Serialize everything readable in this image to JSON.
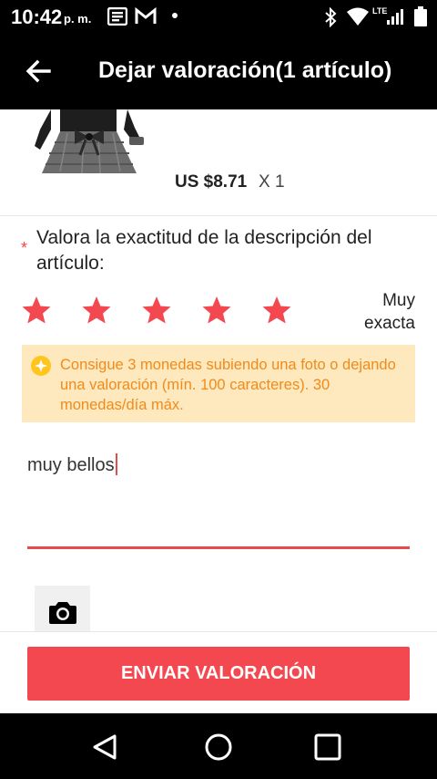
{
  "status_bar": {
    "time": "10:42",
    "ampm": "p. m.",
    "network": "LTE"
  },
  "toolbar": {
    "back_icon": "arrow-left-icon",
    "title": "Dejar valoración(1 artículo)"
  },
  "product": {
    "price": "US $8.71",
    "quantity": "X 1"
  },
  "rating": {
    "required_mark": "*",
    "question": "Valora la exactitud de la descripción del artículo:",
    "stars_selected": 5,
    "stars_total": 5,
    "label": "Muy exacta",
    "star_color": "#f44850"
  },
  "coins_tip": {
    "icon": "coin-icon",
    "text": "Consigue 3 monedas subiendo una foto o dejando una valoración (mín. 100 caracteres). 30 monedas/día máx.",
    "text_color": "#f28a1a",
    "background": "#fde9bd"
  },
  "review": {
    "value": "muy bellos"
  },
  "photo": {
    "icon": "camera-icon"
  },
  "submit": {
    "label": "ENVIAR VALORACIÓN",
    "color": "#f44850"
  },
  "nav": {
    "back_icon": "nav-back-icon",
    "home_icon": "nav-home-icon",
    "recents_icon": "nav-recents-icon"
  }
}
